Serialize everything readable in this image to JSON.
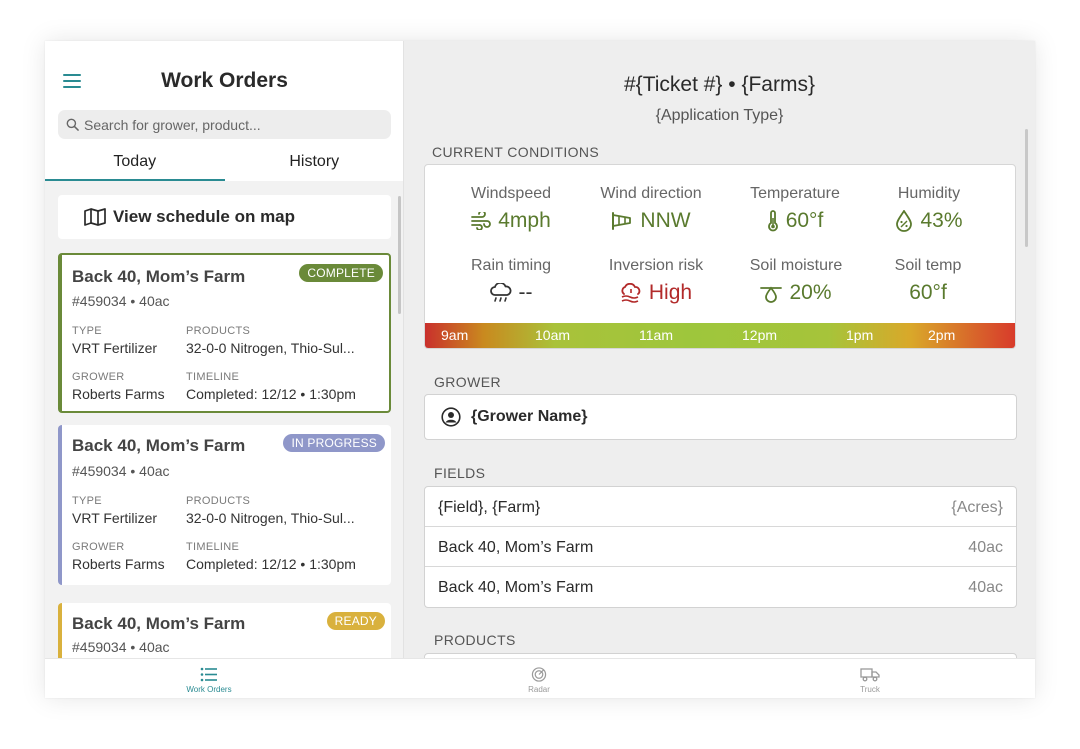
{
  "left_panel": {
    "title": "Work Orders",
    "search_placeholder": "Search for grower, product...",
    "tabs": [
      {
        "label": "Today",
        "active": true
      },
      {
        "label": "History",
        "active": false
      }
    ],
    "map_button_label": "View schedule on map",
    "cards": [
      {
        "title": "Back 40, Mom’s Farm",
        "subtitle": "#459034 • 40ac",
        "status": "COMPLETE",
        "status_color": "#6a8a39",
        "accent_color": "#6a8a39",
        "selected": true,
        "type_label": "TYPE",
        "type": "VRT Fertilizer",
        "products_label": "PRODUCTS",
        "products": "32-0-0 Nitrogen, Thio-Sul...",
        "grower_label": "GROWER",
        "grower": "Roberts Farms",
        "timeline_label": "TIMELINE",
        "timeline": "Completed: 12/12 • 1:30pm"
      },
      {
        "title": "Back 40, Mom’s Farm",
        "subtitle": "#459034 • 40ac",
        "status": "IN PROGRESS",
        "status_color": "#8f97c9",
        "accent_color": "#8f97c9",
        "selected": false,
        "type_label": "TYPE",
        "type": "VRT Fertilizer",
        "products_label": "PRODUCTS",
        "products": "32-0-0 Nitrogen, Thio-Sul...",
        "grower_label": "GROWER",
        "grower": "Roberts Farms",
        "timeline_label": "TIMELINE",
        "timeline": "Completed: 12/12 • 1:30pm"
      },
      {
        "title": "Back 40, Mom’s Farm",
        "subtitle": "#459034 • 40ac",
        "status": "READY",
        "status_color": "#d9b13d",
        "accent_color": "#d9b13d",
        "selected": false
      }
    ]
  },
  "detail": {
    "title": "#{Ticket #} • {Farms}",
    "subtitle": "{Application Type}",
    "conditions_label": "CURRENT CONDITIONS",
    "metrics": [
      {
        "label": "Windspeed",
        "value": "4mph",
        "icon": "wind-icon",
        "color": "#5a7a2e"
      },
      {
        "label": "Wind direction",
        "value": "NNW",
        "icon": "windsock-icon",
        "color": "#5a7a2e"
      },
      {
        "label": "Temperature",
        "value": "60°f",
        "icon": "thermometer-icon",
        "color": "#5a7a2e"
      },
      {
        "label": "Humidity",
        "value": "43%",
        "icon": "humidity-icon",
        "color": "#5a7a2e"
      },
      {
        "label": "Rain timing",
        "value": "--",
        "icon": "rain-icon",
        "color": "#333333"
      },
      {
        "label": "Inversion risk",
        "value": "High",
        "icon": "inversion-icon",
        "color": "#b22a2a"
      },
      {
        "label": "Soil moisture",
        "value": "20%",
        "icon": "soil-moisture-icon",
        "color": "#5a7a2e"
      },
      {
        "label": "Soil temp",
        "value": "60°f",
        "icon": "",
        "color": "#5a7a2e"
      }
    ],
    "timeline_hours": [
      "9am",
      "10am",
      "11am",
      "12pm",
      "1pm",
      "2pm"
    ],
    "grower_label": "GROWER",
    "grower_name": "{Grower Name}",
    "fields_label": "FIELDS",
    "fields": [
      {
        "name": "{Field}, {Farm}",
        "acres": "{Acres}"
      },
      {
        "name": "Back 40, Mom’s Farm",
        "acres": "40ac"
      },
      {
        "name": "Back 40, Mom’s Farm",
        "acres": "40ac"
      }
    ],
    "products_label": "PRODUCTS"
  },
  "bottom_nav": [
    {
      "label": "Work Orders",
      "icon": "list-icon",
      "active": true
    },
    {
      "label": "Radar",
      "icon": "radar-icon",
      "active": false
    },
    {
      "label": "Truck",
      "icon": "truck-icon",
      "active": false
    }
  ]
}
